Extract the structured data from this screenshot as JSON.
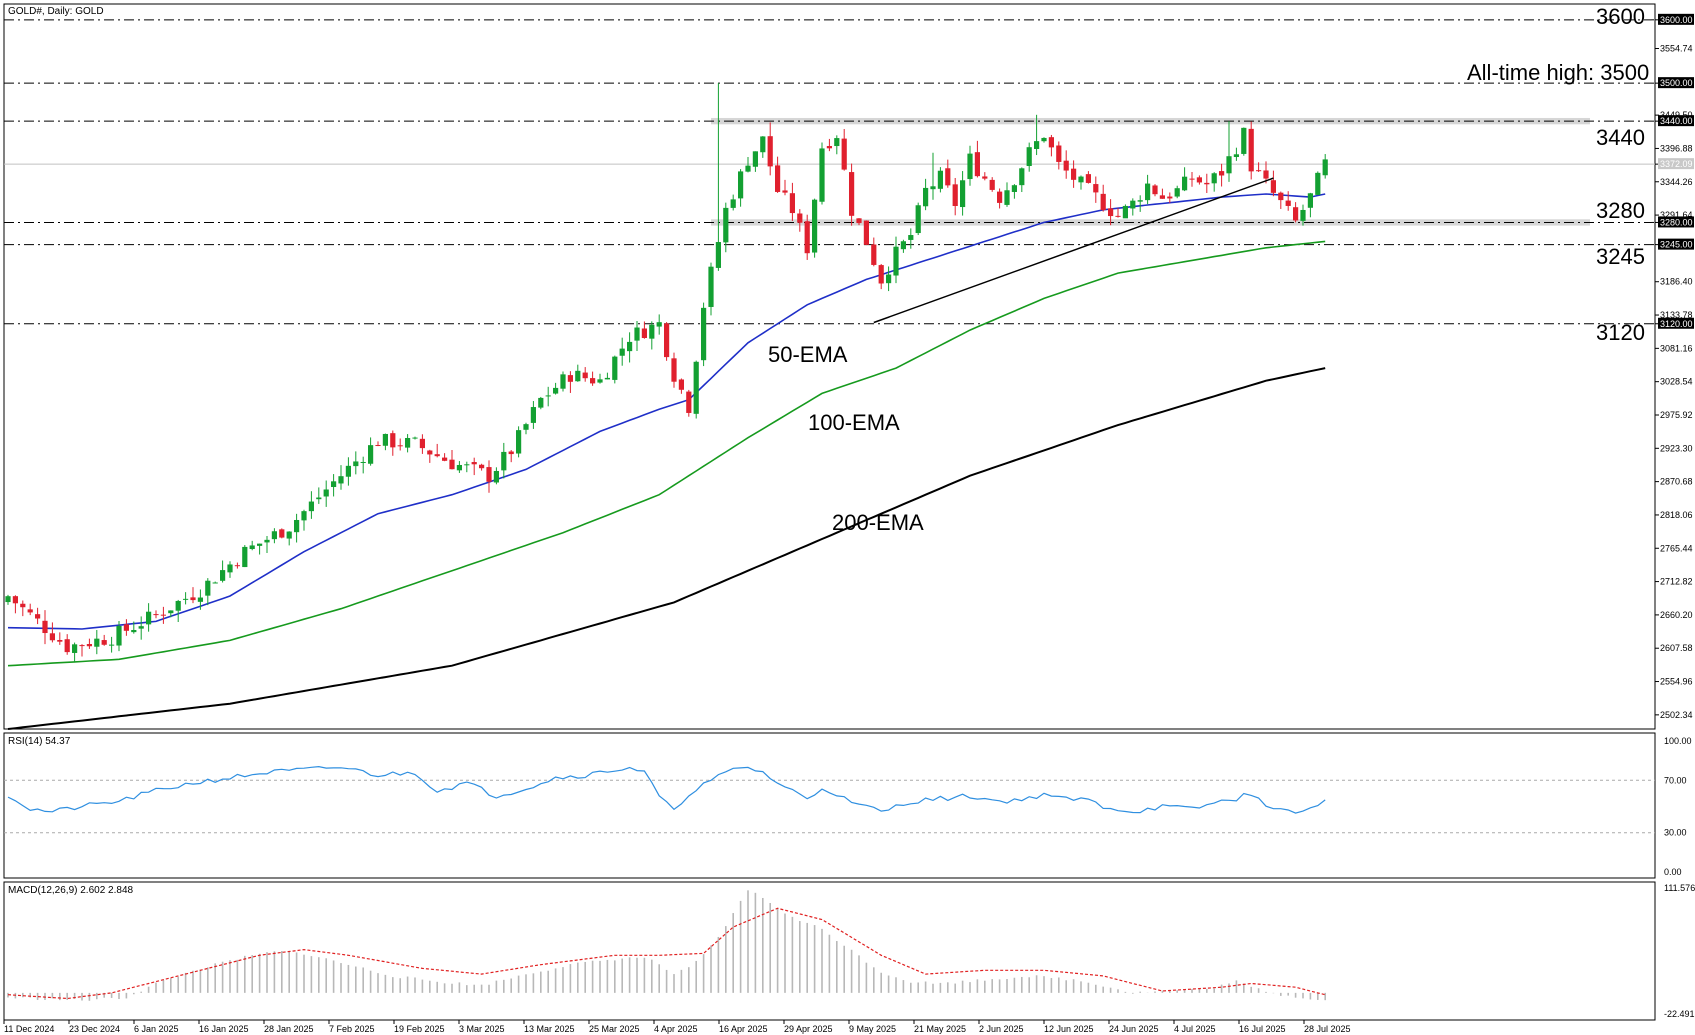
{
  "chart_title": "GOLD#, Daily: GOLD",
  "colors": {
    "bull": "#13a032",
    "bear": "#e0202e",
    "ema50": "#1f2fc8",
    "ema100": "#169a1e",
    "ema200": "#000000",
    "rsi": "#2f8fe0",
    "macd_signal": "#e02020",
    "macd_hist": "#b8b8b8"
  },
  "price_axis": {
    "ticks": [
      "3600.00",
      "3554.74",
      "3500.00",
      "3449.50",
      "3440.00",
      "3396.88",
      "3372.09",
      "3344.26",
      "3291.64",
      "3280.00",
      "3245.00",
      "3186.40",
      "3133.78",
      "3120.00",
      "3081.16",
      "3028.54",
      "2975.92",
      "2923.30",
      "2870.68",
      "2818.06",
      "2765.44",
      "2712.82",
      "2660.20",
      "2607.58",
      "2554.96",
      "2502.34"
    ],
    "current": "3372.09"
  },
  "levels": {
    "l3600": "3600",
    "l3500": "All-time high: 3500",
    "l3440": "3440",
    "l3280": "3280",
    "l3245": "3245",
    "l3120": "3120"
  },
  "ema_labels": {
    "ema50": "50-EMA",
    "ema100": "100-EMA",
    "ema200": "200-EMA"
  },
  "rsi": {
    "title": "RSI(14) 54.37",
    "ticks": [
      "100.00",
      "70.00",
      "30.00",
      "0.00"
    ]
  },
  "macd": {
    "title": "MACD(12,26,9) 2.602 2.848",
    "ticks": [
      "111.576",
      "-22.491"
    ]
  },
  "date_labels": [
    "11 Dec 2024",
    "23 Dec 2024",
    "6 Jan 2025",
    "16 Jan 2025",
    "28 Jan 2025",
    "7 Feb 2025",
    "19 Feb 2025",
    "3 Mar 2025",
    "13 Mar 2025",
    "25 Mar 2025",
    "4 Apr 2025",
    "16 Apr 2025",
    "29 Apr 2025",
    "9 May 2025",
    "21 May 2025",
    "2 Jun 2025",
    "12 Jun 2025",
    "24 Jun 2025",
    "4 Jul 2025",
    "16 Jul 2025",
    "28 Jul 2025"
  ],
  "chart_data": {
    "type": "candlestick",
    "symbol": "GOLD#",
    "timeframe": "Daily",
    "y_range": [
      2480,
      3625
    ],
    "close_anchors": [
      [
        0,
        2690
      ],
      [
        5,
        2640
      ],
      [
        8,
        2610
      ],
      [
        14,
        2625
      ],
      [
        20,
        2660
      ],
      [
        26,
        2700
      ],
      [
        32,
        2760
      ],
      [
        38,
        2800
      ],
      [
        44,
        2870
      ],
      [
        50,
        2935
      ],
      [
        55,
        2930
      ],
      [
        60,
        2900
      ],
      [
        65,
        2880
      ],
      [
        68,
        2920
      ],
      [
        72,
        3000
      ],
      [
        76,
        3040
      ],
      [
        80,
        3030
      ],
      [
        84,
        3100
      ],
      [
        88,
        3120
      ],
      [
        90,
        3040
      ],
      [
        92,
        2990
      ],
      [
        94,
        3150
      ],
      [
        97,
        3300
      ],
      [
        100,
        3380
      ],
      [
        102,
        3410
      ],
      [
        104,
        3330
      ],
      [
        106,
        3300
      ],
      [
        108,
        3240
      ],
      [
        110,
        3400
      ],
      [
        112,
        3420
      ],
      [
        114,
        3300
      ],
      [
        116,
        3250
      ],
      [
        118,
        3190
      ],
      [
        120,
        3230
      ],
      [
        122,
        3260
      ],
      [
        124,
        3330
      ],
      [
        126,
        3350
      ],
      [
        128,
        3310
      ],
      [
        130,
        3380
      ],
      [
        132,
        3350
      ],
      [
        134,
        3320
      ],
      [
        136,
        3350
      ],
      [
        138,
        3390
      ],
      [
        140,
        3420
      ],
      [
        142,
        3370
      ],
      [
        144,
        3350
      ],
      [
        146,
        3330
      ],
      [
        148,
        3310
      ],
      [
        150,
        3290
      ],
      [
        152,
        3310
      ],
      [
        154,
        3340
      ],
      [
        156,
        3320
      ],
      [
        158,
        3330
      ],
      [
        160,
        3350
      ],
      [
        162,
        3340
      ],
      [
        164,
        3360
      ],
      [
        166,
        3400
      ],
      [
        167,
        3420
      ],
      [
        168,
        3370
      ],
      [
        170,
        3340
      ],
      [
        172,
        3310
      ],
      [
        174,
        3280
      ],
      [
        176,
        3320
      ],
      [
        178,
        3372
      ]
    ],
    "highlights": [
      [
        96,
        3500
      ],
      [
        103,
        3438
      ],
      [
        125,
        3390
      ],
      [
        139,
        3450
      ],
      [
        151,
        3292
      ],
      [
        165,
        3440
      ],
      [
        167,
        3430
      ],
      [
        175,
        3275
      ]
    ],
    "ema50_anchors": [
      [
        0,
        2640
      ],
      [
        10,
        2638
      ],
      [
        20,
        2650
      ],
      [
        30,
        2690
      ],
      [
        40,
        2760
      ],
      [
        50,
        2820
      ],
      [
        60,
        2850
      ],
      [
        70,
        2890
      ],
      [
        80,
        2950
      ],
      [
        88,
        2985
      ],
      [
        92,
        3000
      ],
      [
        100,
        3090
      ],
      [
        108,
        3150
      ],
      [
        116,
        3190
      ],
      [
        124,
        3220
      ],
      [
        132,
        3250
      ],
      [
        140,
        3280
      ],
      [
        148,
        3300
      ],
      [
        156,
        3310
      ],
      [
        164,
        3320
      ],
      [
        170,
        3325
      ],
      [
        176,
        3320
      ],
      [
        178,
        3325
      ]
    ],
    "ema100_anchors": [
      [
        0,
        2580
      ],
      [
        15,
        2590
      ],
      [
        30,
        2620
      ],
      [
        45,
        2670
      ],
      [
        60,
        2730
      ],
      [
        75,
        2790
      ],
      [
        88,
        2850
      ],
      [
        100,
        2940
      ],
      [
        110,
        3010
      ],
      [
        120,
        3050
      ],
      [
        130,
        3110
      ],
      [
        140,
        3160
      ],
      [
        150,
        3200
      ],
      [
        160,
        3220
      ],
      [
        170,
        3240
      ],
      [
        178,
        3250
      ]
    ],
    "ema200_anchors": [
      [
        0,
        2480
      ],
      [
        30,
        2520
      ],
      [
        60,
        2580
      ],
      [
        90,
        2680
      ],
      [
        110,
        2780
      ],
      [
        130,
        2880
      ],
      [
        150,
        2960
      ],
      [
        170,
        3030
      ],
      [
        178,
        3050
      ]
    ],
    "trendline": [
      [
        117,
        3122
      ],
      [
        171,
        3350
      ]
    ],
    "support_resistance_zones": [
      [
        3435,
        3445
      ],
      [
        3275,
        3285
      ]
    ],
    "rsi_anchors": [
      [
        0,
        59
      ],
      [
        3,
        48
      ],
      [
        6,
        46
      ],
      [
        10,
        50
      ],
      [
        15,
        54
      ],
      [
        20,
        62
      ],
      [
        25,
        68
      ],
      [
        30,
        72
      ],
      [
        35,
        76
      ],
      [
        40,
        78
      ],
      [
        45,
        80
      ],
      [
        50,
        74
      ],
      [
        55,
        76
      ],
      [
        58,
        62
      ],
      [
        62,
        68
      ],
      [
        66,
        58
      ],
      [
        70,
        64
      ],
      [
        74,
        72
      ],
      [
        78,
        74
      ],
      [
        82,
        78
      ],
      [
        84,
        80
      ],
      [
        86,
        76
      ],
      [
        88,
        58
      ],
      [
        90,
        46
      ],
      [
        92,
        60
      ],
      [
        95,
        70
      ],
      [
        98,
        78
      ],
      [
        100,
        80
      ],
      [
        102,
        76
      ],
      [
        104,
        68
      ],
      [
        106,
        62
      ],
      [
        108,
        56
      ],
      [
        110,
        64
      ],
      [
        112,
        60
      ],
      [
        114,
        52
      ],
      [
        116,
        50
      ],
      [
        118,
        46
      ],
      [
        122,
        54
      ],
      [
        126,
        56
      ],
      [
        130,
        58
      ],
      [
        134,
        54
      ],
      [
        138,
        56
      ],
      [
        140,
        60
      ],
      [
        142,
        56
      ],
      [
        146,
        55
      ],
      [
        148,
        50
      ],
      [
        152,
        46
      ],
      [
        156,
        50
      ],
      [
        160,
        48
      ],
      [
        164,
        54
      ],
      [
        166,
        56
      ],
      [
        167,
        60
      ],
      [
        170,
        52
      ],
      [
        172,
        48
      ],
      [
        174,
        44
      ],
      [
        176,
        50
      ],
      [
        178,
        54
      ]
    ],
    "rsi_range": [
      0,
      100
    ],
    "macd_hist_anchors": [
      [
        0,
        -5
      ],
      [
        10,
        -8
      ],
      [
        16,
        -5
      ],
      [
        20,
        10
      ],
      [
        26,
        26
      ],
      [
        32,
        38
      ],
      [
        36,
        44
      ],
      [
        40,
        42
      ],
      [
        46,
        30
      ],
      [
        52,
        18
      ],
      [
        58,
        12
      ],
      [
        64,
        8
      ],
      [
        70,
        20
      ],
      [
        76,
        30
      ],
      [
        82,
        36
      ],
      [
        86,
        38
      ],
      [
        88,
        30
      ],
      [
        90,
        20
      ],
      [
        92,
        26
      ],
      [
        94,
        40
      ],
      [
        97,
        70
      ],
      [
        99,
        98
      ],
      [
        100,
        110
      ],
      [
        103,
        96
      ],
      [
        106,
        80
      ],
      [
        110,
        68
      ],
      [
        114,
        45
      ],
      [
        118,
        22
      ],
      [
        122,
        12
      ],
      [
        126,
        10
      ],
      [
        132,
        14
      ],
      [
        138,
        18
      ],
      [
        144,
        14
      ],
      [
        148,
        8
      ],
      [
        152,
        0
      ],
      [
        156,
        2
      ],
      [
        162,
        4
      ],
      [
        166,
        12
      ],
      [
        168,
        6
      ],
      [
        172,
        -2
      ],
      [
        176,
        -6
      ],
      [
        178,
        -8
      ]
    ],
    "macd_signal_anchors": [
      [
        0,
        -2
      ],
      [
        8,
        -6
      ],
      [
        14,
        0
      ],
      [
        24,
        20
      ],
      [
        34,
        40
      ],
      [
        40,
        46
      ],
      [
        46,
        40
      ],
      [
        56,
        26
      ],
      [
        64,
        20
      ],
      [
        72,
        30
      ],
      [
        82,
        40
      ],
      [
        88,
        40
      ],
      [
        94,
        42
      ],
      [
        98,
        70
      ],
      [
        104,
        90
      ],
      [
        110,
        78
      ],
      [
        118,
        40
      ],
      [
        124,
        20
      ],
      [
        132,
        24
      ],
      [
        140,
        24
      ],
      [
        148,
        18
      ],
      [
        156,
        2
      ],
      [
        164,
        6
      ],
      [
        168,
        10
      ],
      [
        174,
        6
      ],
      [
        178,
        -2
      ]
    ],
    "macd_range": [
      -22.491,
      111.576
    ]
  }
}
